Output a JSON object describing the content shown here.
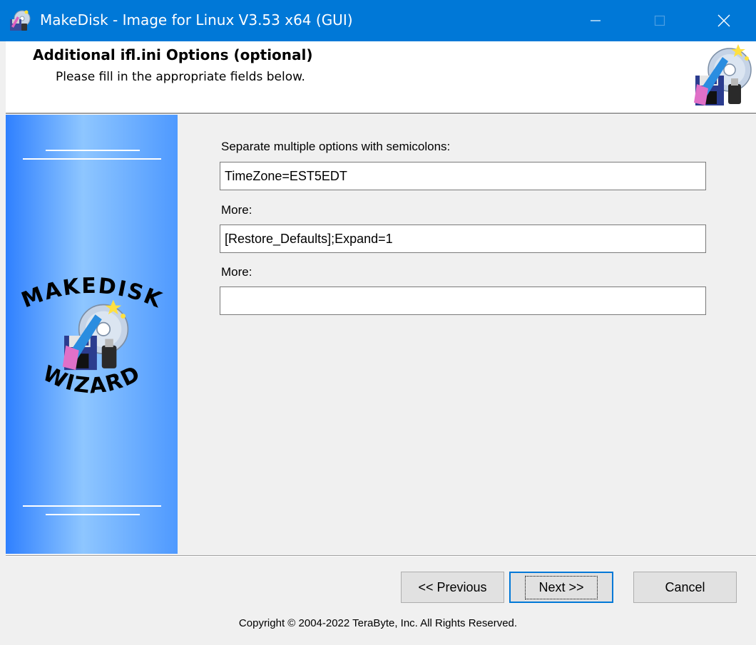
{
  "window": {
    "title": "MakeDisk - Image for Linux V3.53 x64 (GUI)",
    "controls": {
      "minimize_icon": "minimize-icon",
      "maximize_icon": "maximize-icon",
      "close_icon": "close-icon"
    },
    "titlebar_color": "#0078d7"
  },
  "header": {
    "heading": "Additional ifl.ini Options (optional)",
    "subheading": "Please fill in the appropriate fields below.",
    "icon": "makedisk-wizard-icon"
  },
  "sidepanel": {
    "logo_top": "MAKEDISK",
    "logo_bottom": "WIZARD",
    "logo_icon": "makedisk-wizard-icon",
    "gradient_colors": [
      "#2f80ff",
      "#8ec6ff",
      "#4e99ff"
    ]
  },
  "form": {
    "fields": [
      {
        "label": "Separate multiple options with semicolons:",
        "value": "TimeZone=EST5EDT"
      },
      {
        "label": "More:",
        "value": "[Restore_Defaults];Expand=1"
      },
      {
        "label": "More:",
        "value": ""
      }
    ]
  },
  "buttons": {
    "previous": "<< Previous",
    "next": "Next >>",
    "cancel": "Cancel"
  },
  "footer": {
    "copyright": "Copyright © 2004-2022 TeraByte, Inc.  All Rights Reserved."
  }
}
